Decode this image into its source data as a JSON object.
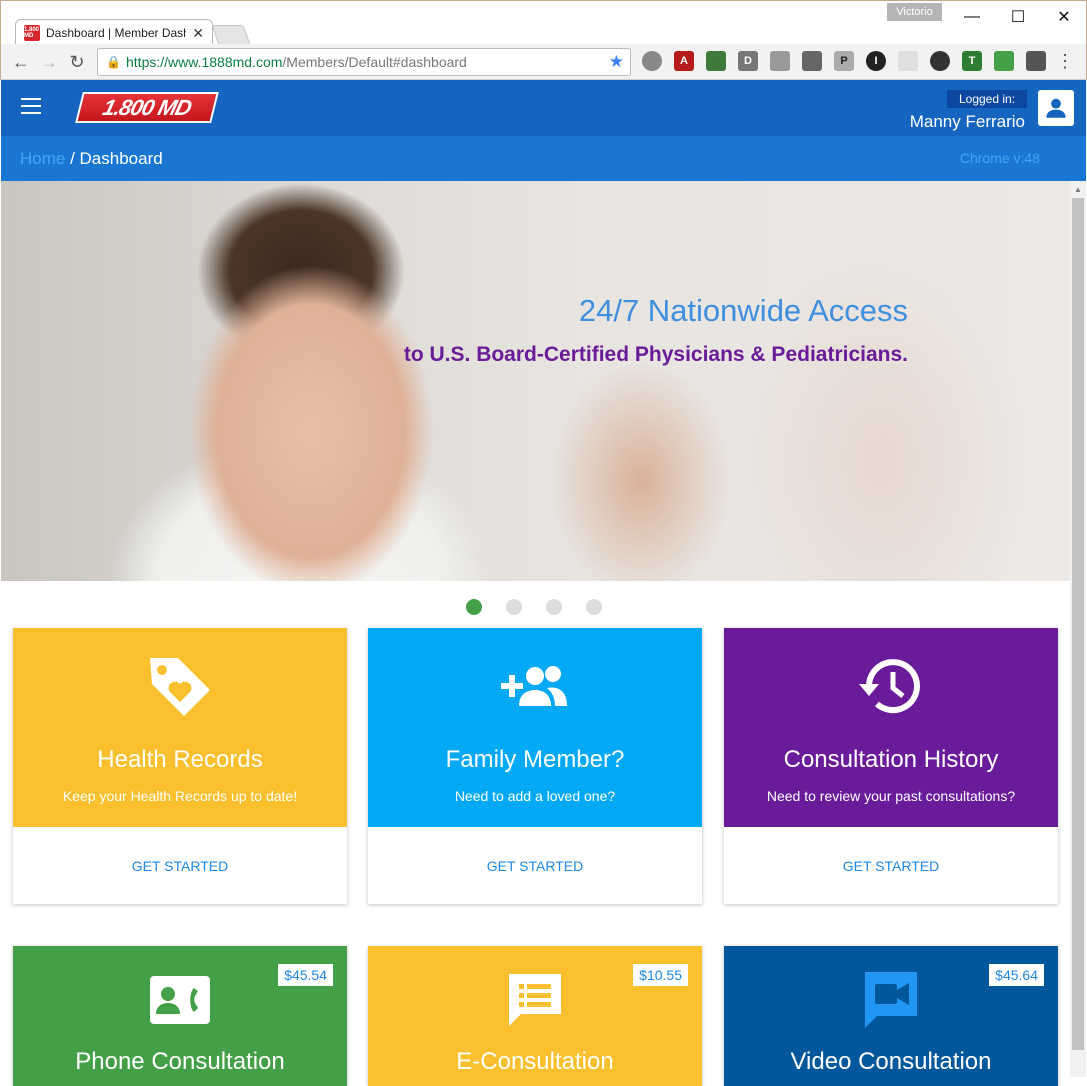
{
  "browser": {
    "tab_title": "Dashboard | Member Dash",
    "favicon_text": "1.800 MD",
    "profile_name": "Victorio",
    "url_host": "https://www.1888md.com",
    "url_path": "/Members/Default#dashboard"
  },
  "header": {
    "logo_text": "1.800 MD",
    "logged_in_label": "Logged in:",
    "user_name": "Manny Ferrario"
  },
  "breadcrumb": {
    "home": "Home",
    "separator": " / ",
    "current": "Dashboard",
    "chrome_version": "Chrome v:48"
  },
  "hero": {
    "title": "24/7 Nationwide Access",
    "subtitle": "to U.S. Board-Certified Physicians & Pediatricians.",
    "slides": 4,
    "active_slide": 1
  },
  "cards": [
    {
      "title": "Health Records",
      "description": "Keep your Health Records up to date!",
      "action": "GET STARTED",
      "color": "#fbc02d",
      "icon": "tag-heart-icon"
    },
    {
      "title": "Family Member?",
      "description": "Need to add a loved one?",
      "action": "GET STARTED",
      "color": "#03a9f4",
      "icon": "add-group-icon"
    },
    {
      "title": "Consultation History",
      "description": "Need to review your past consultations?",
      "action": "GET STARTED",
      "color": "#6a1b9a",
      "icon": "history-icon"
    }
  ],
  "consult_cards": [
    {
      "title": "Phone Consultation",
      "price": "$45.54",
      "color": "#43a047",
      "icon": "phone-contact-icon"
    },
    {
      "title": "E-Consultation",
      "price": "$10.55",
      "color": "#fbc02d",
      "icon": "chat-list-icon"
    },
    {
      "title": "Video Consultation",
      "price": "$45.64",
      "color": "#01579b",
      "icon": "video-icon"
    }
  ],
  "colors": {
    "header_blue": "#1565c0",
    "breadcrumb_blue": "#1976d2",
    "link_blue": "#1e88e5"
  }
}
